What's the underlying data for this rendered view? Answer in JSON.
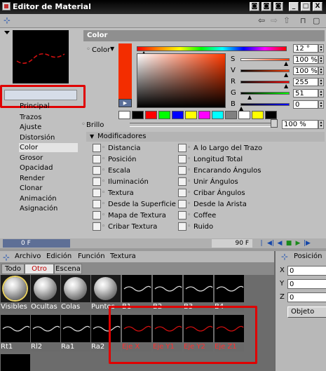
{
  "window": {
    "title": "Editor de Material",
    "buttons": [
      "◙",
      "◙",
      "◙",
      "_",
      "□",
      "X"
    ]
  },
  "toolbar": {
    "left_icon": "pin-icon",
    "nav_back": "⇦",
    "nav_forward": "⇨",
    "nav_up": "⇧",
    "lock": "🔓",
    "new_window": "▢"
  },
  "material": {
    "name": "",
    "channels": [
      "Principal",
      "Trazos",
      "Ajuste",
      "Distorsión",
      "Color",
      "Grosor",
      "Opacidad",
      "Render",
      "Clonar",
      "Animación",
      "Asignación"
    ],
    "selected_channel": "Color"
  },
  "color_panel": {
    "heading": "Color",
    "label": "Color",
    "mode_arrow": "▼",
    "swatch_color": "#f32d00",
    "swatch_button": "▶",
    "fields": [
      {
        "label": "H",
        "value": "12 °"
      },
      {
        "label": "S",
        "value": "100 %"
      },
      {
        "label": "V",
        "value": "100 %"
      },
      {
        "label": "R",
        "value": "255"
      },
      {
        "label": "G",
        "value": "51"
      },
      {
        "label": "B",
        "value": "0"
      }
    ],
    "palette": [
      "#ffffff",
      "#000000",
      "#ff0000",
      "#00ff00",
      "#0000ff",
      "#ffff00",
      "#ff00ff",
      "#00ffff",
      "#808080",
      "#ffffff",
      "#ffff00",
      "#000000"
    ],
    "brightness_label": "Brillo",
    "brightness_value": "100 %"
  },
  "modifiers": {
    "heading": "Modificadores",
    "left": [
      "Distancia",
      "Posición",
      "Escala",
      "Iluminación",
      "Textura",
      "Desde la Superficie",
      "Mapa de Textura",
      "Cribar Textura"
    ],
    "right": [
      "A lo Largo del Trazo",
      "Longitud Total",
      "Encarando Ángulos",
      "Unir Ángulos",
      "Cribar Ángulos",
      "Desde la Arista",
      "Coffee",
      "Ruido"
    ]
  },
  "timeline": {
    "start": "0 F",
    "end": "90 F",
    "buttons": [
      "|◀◀",
      "◀|",
      "◀",
      "■",
      "▶",
      "|▶"
    ]
  },
  "material_manager": {
    "menu": [
      "Archivo",
      "Edición",
      "Función",
      "Textura"
    ],
    "tabs": [
      "Todo",
      "Otro",
      "Escena"
    ],
    "active_tab": "Otro",
    "row1": [
      {
        "label": "Visibles",
        "kind": "sphere",
        "selected": true
      },
      {
        "label": "Ocultas",
        "kind": "sphere",
        "selected": false
      },
      {
        "label": "Colas",
        "kind": "sphere",
        "selected": false
      },
      {
        "label": "Puntos",
        "kind": "sphere",
        "selected": false
      },
      {
        "label": "B1",
        "kind": "curve"
      },
      {
        "label": "B2",
        "kind": "curve"
      },
      {
        "label": "B3",
        "kind": "curve"
      },
      {
        "label": "B4",
        "kind": "curve"
      }
    ],
    "row2": [
      {
        "label": "Rt1",
        "kind": "curve"
      },
      {
        "label": "Rl2",
        "kind": "curve"
      },
      {
        "label": "Ra1",
        "kind": "curve"
      },
      {
        "label": "Ra2",
        "kind": "curve"
      },
      {
        "label": "Eje X",
        "kind": "curve-red"
      },
      {
        "label": "Eje Y1",
        "kind": "curve-red"
      },
      {
        "label": "Eje Y2",
        "kind": "curve-red"
      },
      {
        "label": "Eje Z1",
        "kind": "curve-red"
      }
    ]
  },
  "coordinates": {
    "heading": "Posición",
    "fields": [
      {
        "label": "X",
        "value": "0"
      },
      {
        "label": "Y",
        "value": "0"
      },
      {
        "label": "Z",
        "value": "0"
      }
    ],
    "object_button": "Objeto"
  },
  "highlight_color": "#e00000"
}
